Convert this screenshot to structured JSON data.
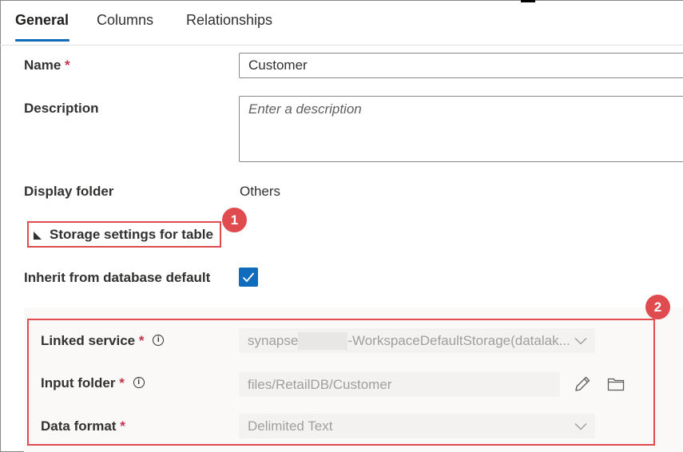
{
  "tabs": [
    {
      "label": "General",
      "active": true
    },
    {
      "label": "Columns",
      "active": false
    },
    {
      "label": "Relationships",
      "active": false
    }
  ],
  "form": {
    "name_label": "Name",
    "name_value": "Customer",
    "description_label": "Description",
    "description_placeholder": "Enter a description",
    "display_folder_label": "Display folder",
    "display_folder_value": "Others",
    "storage_toggle_label": "Storage settings for table",
    "inherit_label": "Inherit from database default",
    "inherit_checked": true
  },
  "storage": {
    "linked_service_label": "Linked service",
    "linked_service_prefix": "synapse",
    "linked_service_suffix": "-WorkspaceDefaultStorage(datalak...",
    "input_folder_label": "Input folder",
    "input_folder_value": "files/RetailDB/Customer",
    "data_format_label": "Data format",
    "data_format_value": "Delimited Text"
  },
  "required_marker": "*",
  "info_glyph": "i",
  "annotations": {
    "badge1": "1",
    "badge2": "2"
  },
  "colors": {
    "accent": "#0f6cbd",
    "highlight_red": "#e04b50",
    "required_red": "#c4314b"
  },
  "icons": [
    "triangle-expand-icon",
    "checkmark-icon",
    "info-icon",
    "chevron-down-icon",
    "pencil-icon",
    "folder-icon"
  ]
}
